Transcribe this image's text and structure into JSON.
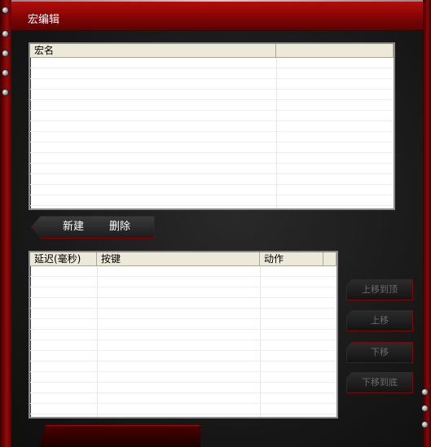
{
  "window": {
    "title": "宏编辑"
  },
  "macro_table": {
    "columns": [
      "宏名",
      ""
    ],
    "rows": []
  },
  "buttons": {
    "new": "新建",
    "delete": "删除"
  },
  "step_table": {
    "columns": [
      "延迟(毫秒)",
      "按键",
      "动作",
      ""
    ],
    "rows": []
  },
  "side_buttons": {
    "move_top": "上移到顶",
    "move_up": "上移",
    "move_down": "下移",
    "move_bottom": "下移到底"
  }
}
